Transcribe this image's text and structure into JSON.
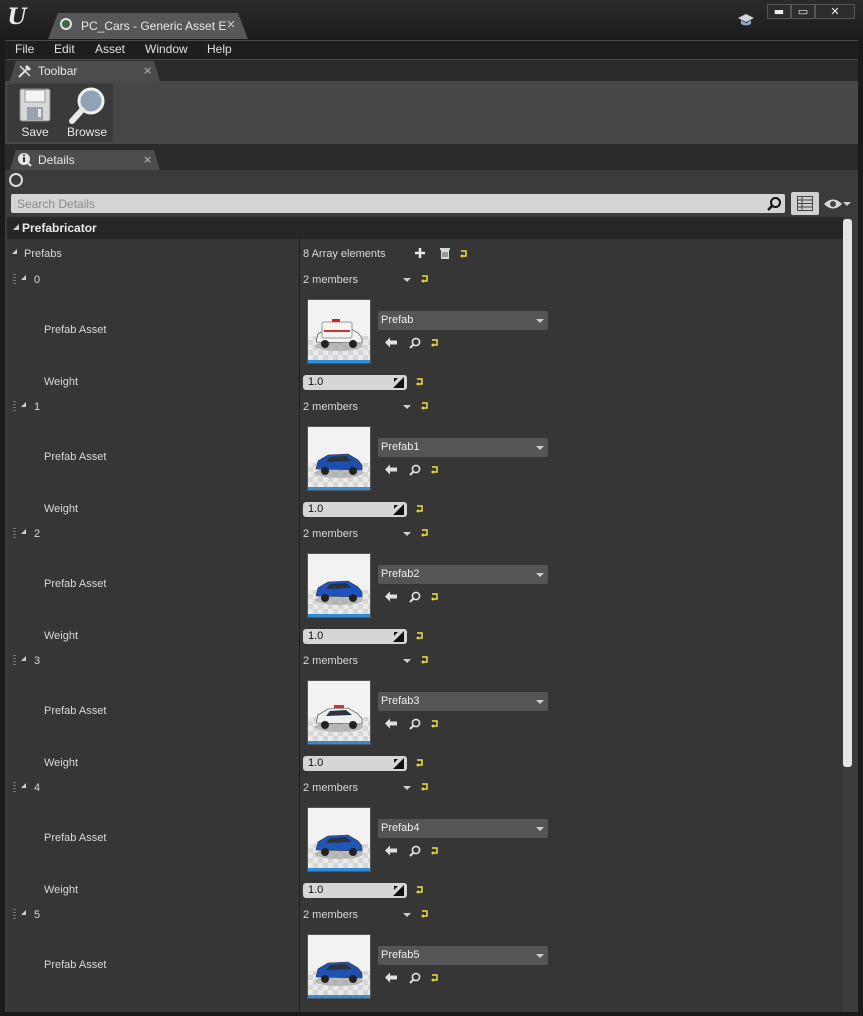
{
  "window": {
    "tab_title": "PC_Cars - Generic Asset E",
    "close_glyph": "×",
    "minimize_glyph": "▬",
    "maximize_glyph": "▭",
    "close_window_glyph": "✕"
  },
  "menu": [
    "File",
    "Edit",
    "Asset",
    "Window",
    "Help"
  ],
  "toolbar": {
    "tab_label": "Toolbar",
    "save_label": "Save",
    "browse_label": "Browse"
  },
  "details": {
    "tab_label": "Details",
    "search_placeholder": "Search Details",
    "category": "Prefabricator",
    "prefabs_label": "Prefabs",
    "array_count": "8 Array elements",
    "accent_color": "#2e8ddb",
    "elements": [
      {
        "index": "0",
        "members": "2 members",
        "asset_label": "Prefab Asset",
        "asset": "Prefab",
        "weight_label": "Weight",
        "weight": "1.0",
        "thumb_icon": "ambulance",
        "car_color": "#f3f3f3"
      },
      {
        "index": "1",
        "members": "2 members",
        "asset_label": "Prefab Asset",
        "asset": "Prefab1",
        "weight_label": "Weight",
        "weight": "1.0",
        "thumb_icon": "suv",
        "car_color": "#1f4fae"
      },
      {
        "index": "2",
        "members": "2 members",
        "asset_label": "Prefab Asset",
        "asset": "Prefab2",
        "weight_label": "Weight",
        "weight": "1.0",
        "thumb_icon": "sports-car",
        "car_color": "#1d52c4"
      },
      {
        "index": "3",
        "members": "2 members",
        "asset_label": "Prefab Asset",
        "asset": "Prefab3",
        "weight_label": "Weight",
        "weight": "1.0",
        "thumb_icon": "police-car",
        "car_color": "#eef0f0"
      },
      {
        "index": "4",
        "members": "2 members",
        "asset_label": "Prefab Asset",
        "asset": "Prefab4",
        "weight_label": "Weight",
        "weight": "1.0",
        "thumb_icon": "sedan",
        "car_color": "#2056b8"
      },
      {
        "index": "5",
        "members": "2 members",
        "asset_label": "Prefab Asset",
        "asset": "Prefab5",
        "thumb_icon": "hatchback",
        "car_color": "#2050b0"
      }
    ]
  }
}
